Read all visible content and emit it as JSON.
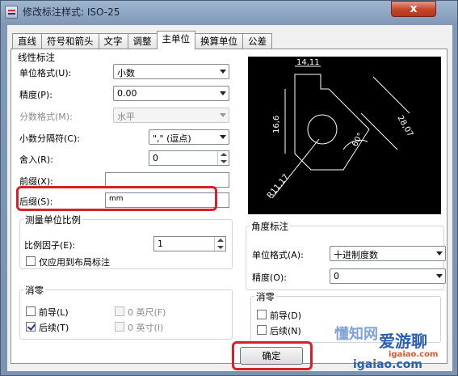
{
  "window": {
    "title": "修改标注样式: ISO-25",
    "close_glyph": "x"
  },
  "tabs": [
    "直线",
    "符号和箭头",
    "文字",
    "调整",
    "主单位",
    "换算单位",
    "公差"
  ],
  "linear": {
    "group_title": "线性标注",
    "unit_format_label": "单位格式(U):",
    "unit_format_value": "小数",
    "precision_label": "精度(P):",
    "precision_value": "0.00",
    "fraction_label": "分数格式(M):",
    "fraction_value": "水平",
    "decimal_sep_label": "小数分隔符(C):",
    "decimal_sep_value": "\",\" (逗点)",
    "round_label": "舍入(R):",
    "round_value": "0",
    "prefix_label": "前缀(X):",
    "prefix_value": "",
    "suffix_label": "后缀(S):",
    "suffix_value": "mm"
  },
  "scale": {
    "group_title": "测量单位比例",
    "factor_label": "比例因子(E):",
    "factor_value": "1",
    "layout_only_label": "仅应用到布局标注"
  },
  "zero_left": {
    "group_title": "消零",
    "leading_label": "前导(L)",
    "trailing_label": "后续(T)",
    "feet_label": "0 英尺(F)",
    "inches_label": "0 英寸(I)"
  },
  "angular": {
    "group_title": "角度标注",
    "unit_format_label": "单位格式(A):",
    "unit_format_value": "十进制度数",
    "precision_label": "精度(O):",
    "precision_value": "0"
  },
  "zero_right": {
    "group_title": "消零",
    "leading_label": "前导(D)",
    "trailing_label": "后续(N)"
  },
  "preview": {
    "dim_top": "14,11",
    "dim_left": "16,6",
    "dim_right": "28,07",
    "dim_angle": "60°",
    "dim_radius": "R11,17"
  },
  "buttons": {
    "ok": "确定"
  },
  "watermark": {
    "text1": "懂知网",
    "text2": "爱游聊",
    "url": "igaiao.com",
    "text3": "igaiao.com"
  },
  "colors": {
    "highlight": "#d3232a",
    "preview_bg": "#000000"
  }
}
